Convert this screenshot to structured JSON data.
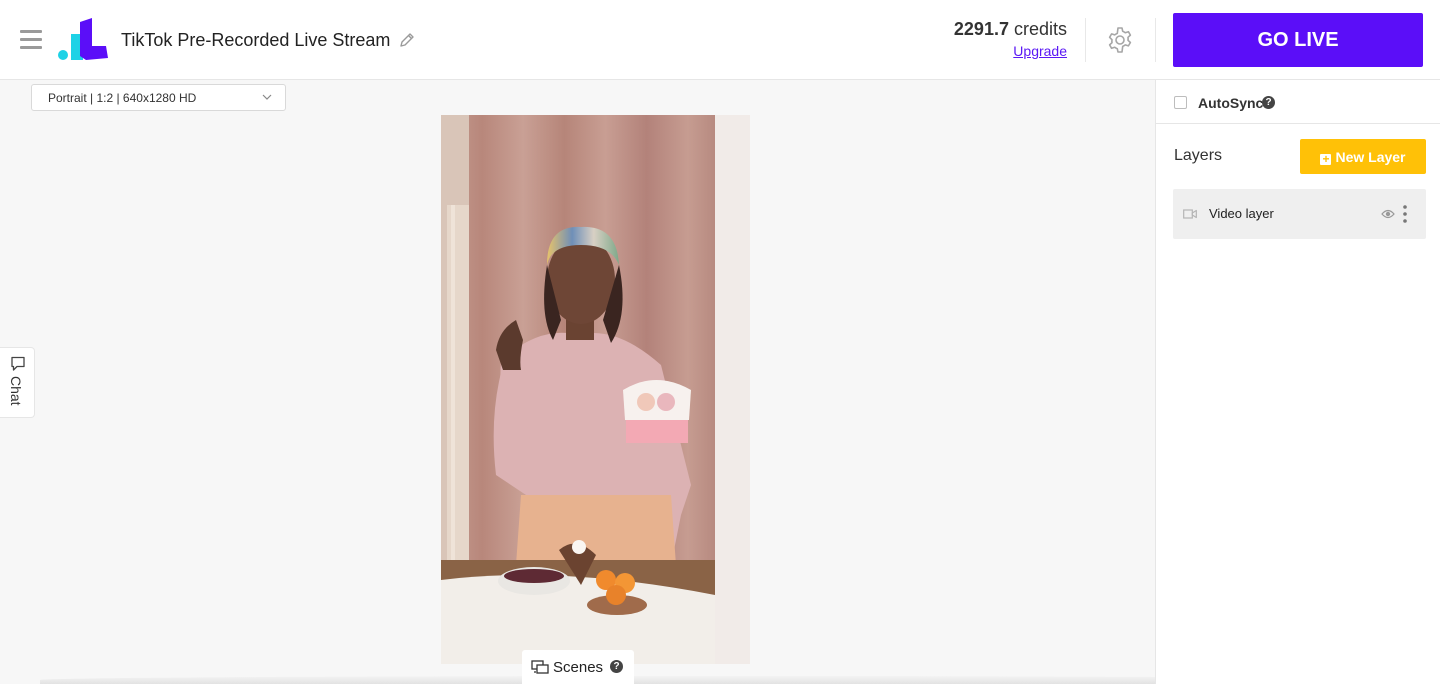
{
  "header": {
    "title": "TikTok Pre-Recorded Live Stream",
    "credits_value": "2291.7",
    "credits_unit": "credits",
    "upgrade_label": "Upgrade",
    "go_live_label": "GO LIVE"
  },
  "canvas": {
    "preset": "Portrait | 1:2 | 640x1280 HD",
    "chat_label": "Chat",
    "scenes_label": "Scenes"
  },
  "panel": {
    "autosync_label": "AutoSync",
    "autosync_checked": false,
    "layers_title": "Layers",
    "new_layer_label": "New Layer",
    "layers": [
      {
        "label": "Video layer"
      }
    ]
  },
  "icons": [
    "menu-icon",
    "logo-icon",
    "edit-icon",
    "gear-icon",
    "chevron-down-icon",
    "chat-icon",
    "scenes-icon",
    "help-icon",
    "plus-icon",
    "video-camera-icon",
    "eye-icon",
    "more-vertical-icon"
  ],
  "colors": {
    "accent": "#5b0ef8",
    "new_layer": "#ffc107",
    "link": "#5b19f5"
  }
}
